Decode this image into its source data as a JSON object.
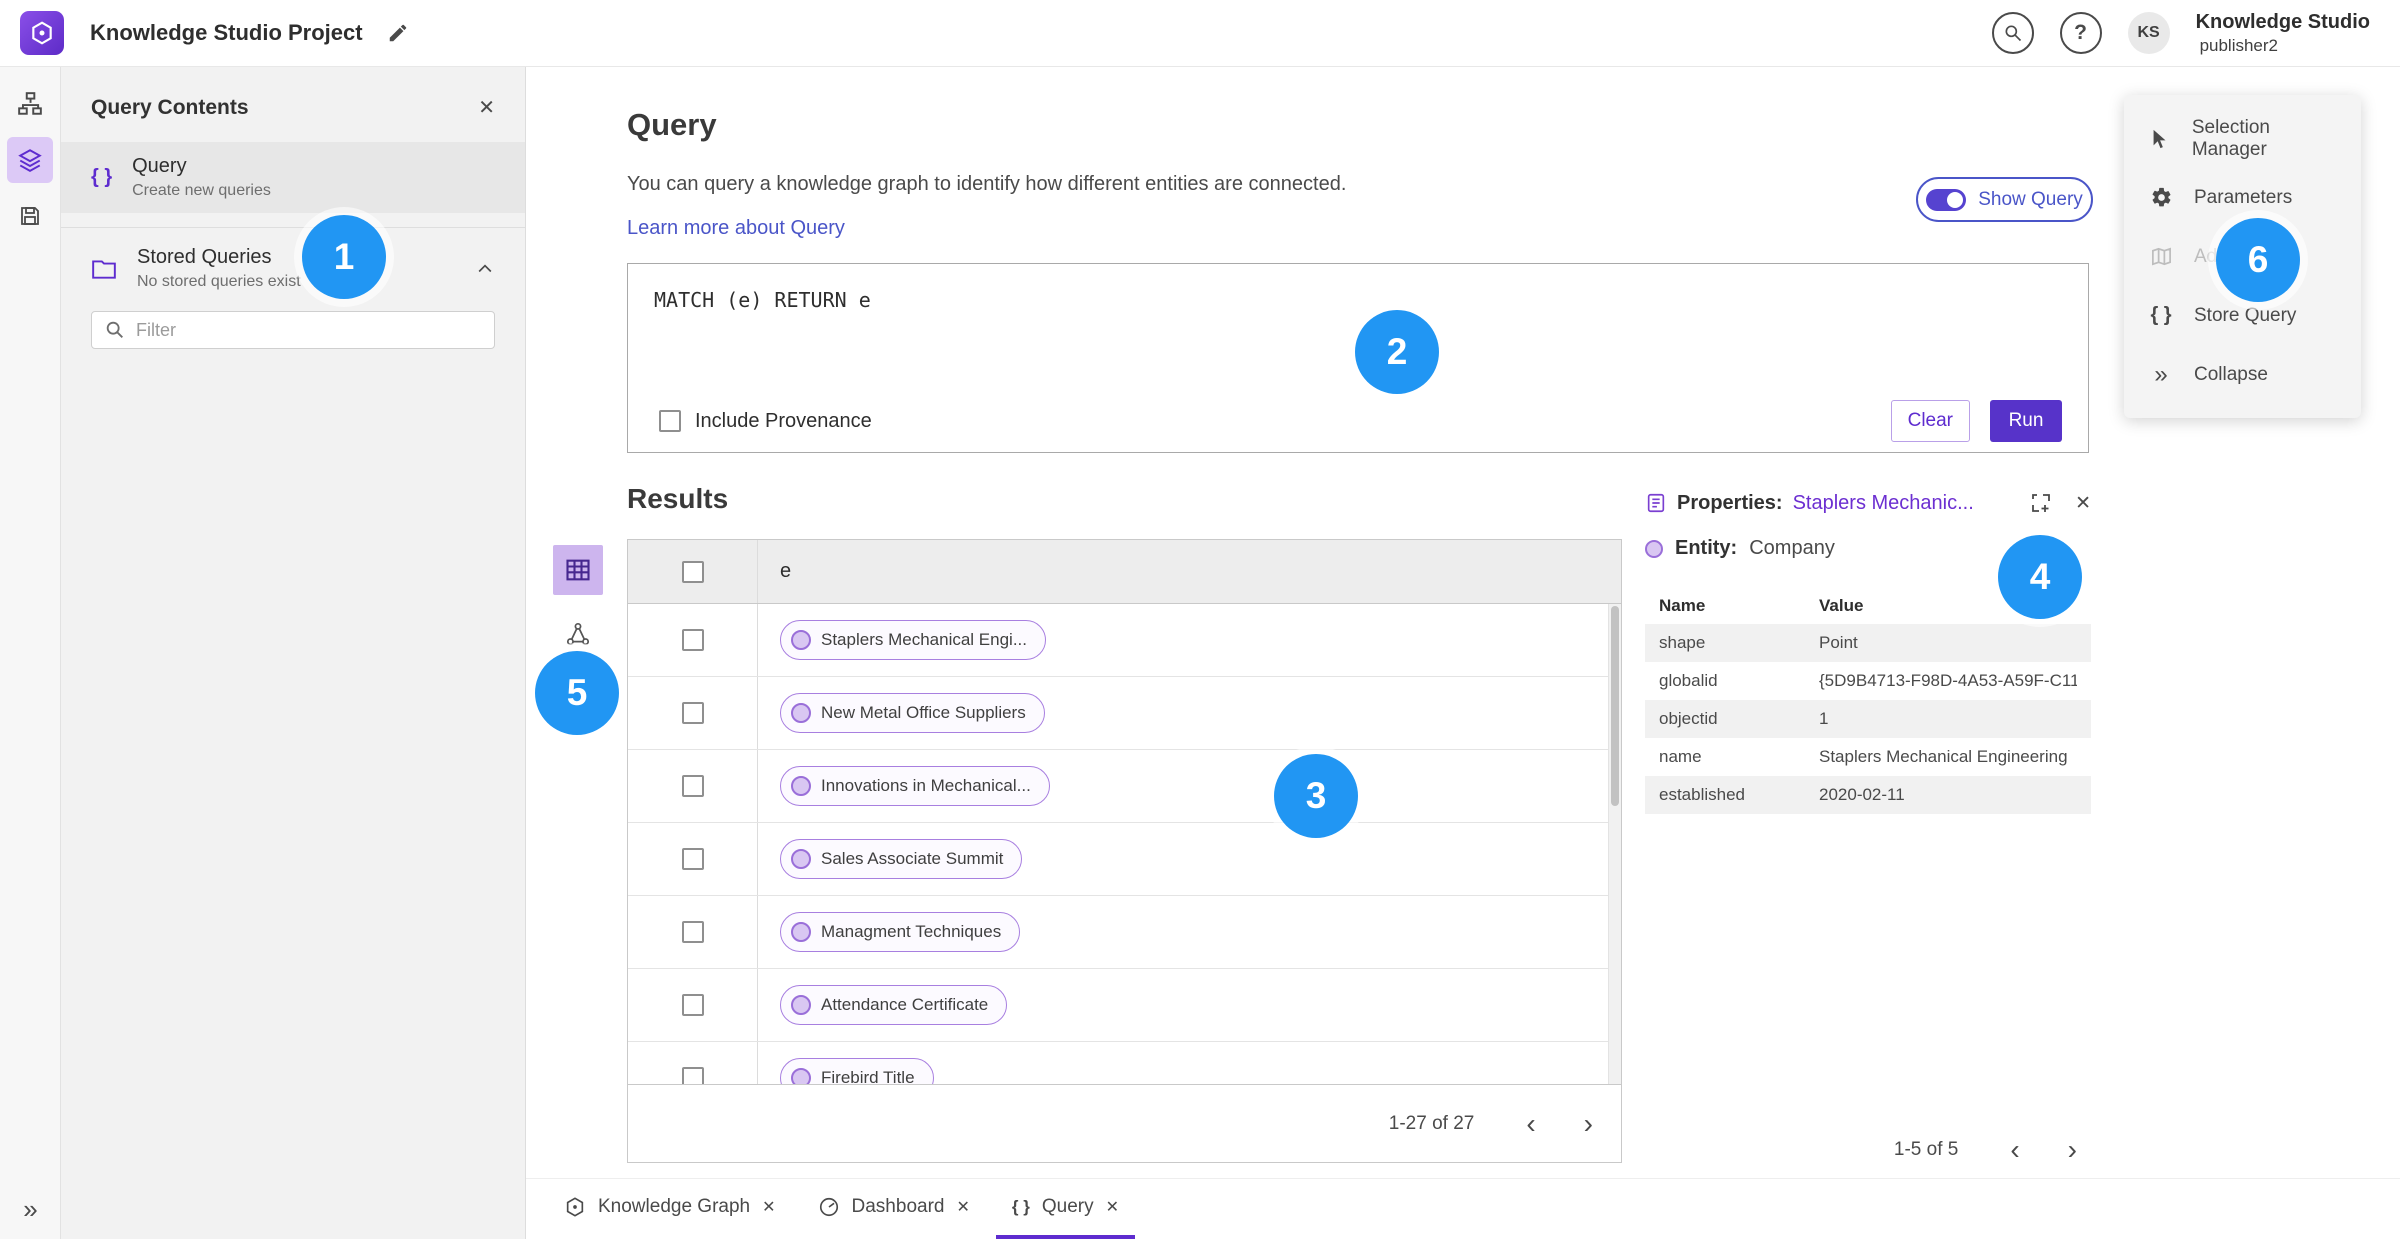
{
  "app": {
    "title": "Knowledge Studio Project",
    "user": {
      "initials": "KS",
      "name": "Knowledge Studio",
      "role": "publisher2"
    }
  },
  "glyphs": {
    "braces": "{ }",
    "close": "✕",
    "collapse": "»",
    "help": "?",
    "prev": "‹",
    "next": "›"
  },
  "colors": {
    "accent_purple": "#5e2cc9",
    "link_blue": "#4a55c8",
    "annotation_blue": "#2196f3"
  },
  "contents_panel": {
    "title": "Query Contents",
    "query_item": {
      "label": "Query",
      "description": "Create new queries"
    },
    "stored_queries": {
      "label": "Stored Queries",
      "description": "No stored queries exist"
    },
    "filter": {
      "placeholder": "Filter"
    }
  },
  "query_section": {
    "title": "Query",
    "description": "You can query a knowledge graph to identify how different entities are connected.",
    "learn_more": "Learn more about Query",
    "show_query": "Show Query",
    "code": "MATCH (e) RETURN e",
    "include_provenance": "Include Provenance",
    "clear": "Clear",
    "run": "Run"
  },
  "results": {
    "title": "Results",
    "column_header": "e",
    "rows": [
      "Staplers Mechanical Engi...",
      "New Metal Office Suppliers",
      "Innovations in Mechanical...",
      "Sales Associate Summit",
      "Managment Techniques",
      "Attendance Certificate",
      "Firebird Title"
    ],
    "pagination": {
      "label": "1-27 of 27"
    }
  },
  "properties_panel": {
    "title": "Properties:",
    "selected_entity": "Staplers Mechanic...",
    "entity_label": "Entity:",
    "entity_type": "Company",
    "columns": {
      "name": "Name",
      "value": "Value"
    },
    "rows": [
      {
        "name": "shape",
        "value": "Point"
      },
      {
        "name": "globalid",
        "value": "{5D9B4713-F98D-4A53-A59F-C11..."
      },
      {
        "name": "objectid",
        "value": "1"
      },
      {
        "name": "name",
        "value": "Staplers Mechanical Engineering"
      },
      {
        "name": "established",
        "value": "2020-02-11"
      }
    ],
    "pagination": {
      "label": "1-5 of 5"
    }
  },
  "actions_menu": {
    "items": [
      {
        "label": "Selection Manager",
        "disabled": false
      },
      {
        "label": "Parameters",
        "disabled": false
      },
      {
        "label": "Add To Map",
        "disabled": true
      },
      {
        "label": "Store Query",
        "disabled": false
      },
      {
        "label": "Collapse",
        "disabled": false
      }
    ]
  },
  "tabs": [
    {
      "label": "Knowledge Graph",
      "active": false
    },
    {
      "label": "Dashboard",
      "active": false
    },
    {
      "label": "Query",
      "active": true
    }
  ],
  "annotations": [
    "1",
    "2",
    "3",
    "4",
    "5",
    "6"
  ]
}
